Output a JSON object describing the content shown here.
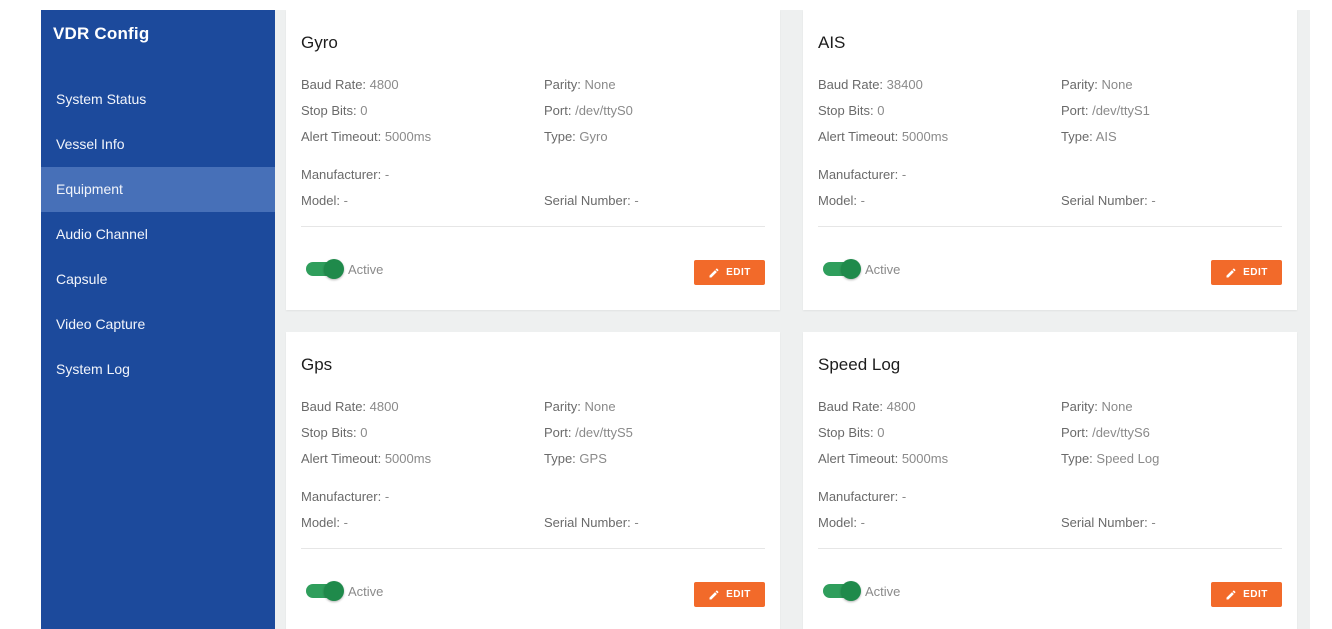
{
  "sidebar": {
    "title": "VDR Config",
    "items": [
      {
        "label": "System Status"
      },
      {
        "label": "Vessel Info"
      },
      {
        "label": "Equipment"
      },
      {
        "label": "Audio Channel"
      },
      {
        "label": "Capsule"
      },
      {
        "label": "Video Capture"
      },
      {
        "label": "System Log"
      }
    ],
    "active_item": "Equipment"
  },
  "labels": {
    "baud_rate": "Baud Rate:",
    "stop_bits": "Stop Bits:",
    "alert_timeout": "Alert Timeout:",
    "parity": "Parity:",
    "port": "Port:",
    "type": "Type:",
    "manufacturer": "Manufacturer:",
    "model": "Model:",
    "serial_number": "Serial Number:",
    "active": "Active",
    "edit": "EDIT"
  },
  "devices": [
    {
      "name": "Gyro",
      "baud_rate": "4800",
      "stop_bits": "0",
      "alert_timeout": "5000ms",
      "parity": "None",
      "port": "/dev/ttyS0",
      "type": "Gyro",
      "manufacturer": "-",
      "model": "-",
      "serial_number": "-",
      "active": true
    },
    {
      "name": "AIS",
      "baud_rate": "38400",
      "stop_bits": "0",
      "alert_timeout": "5000ms",
      "parity": "None",
      "port": "/dev/ttyS1",
      "type": "AIS",
      "manufacturer": "-",
      "model": "-",
      "serial_number": "-",
      "active": true
    },
    {
      "name": "Gps",
      "baud_rate": "4800",
      "stop_bits": "0",
      "alert_timeout": "5000ms",
      "parity": "None",
      "port": "/dev/ttyS5",
      "type": "GPS",
      "manufacturer": "-",
      "model": "-",
      "serial_number": "-",
      "active": true
    },
    {
      "name": "Speed Log",
      "baud_rate": "4800",
      "stop_bits": "0",
      "alert_timeout": "5000ms",
      "parity": "None",
      "port": "/dev/ttyS6",
      "type": "Speed Log",
      "manufacturer": "-",
      "model": "-",
      "serial_number": "-",
      "active": true
    }
  ],
  "colors": {
    "sidebar_bg": "#1c4a9c",
    "sidebar_active": "#4770b8",
    "main_bg": "#eef0f0",
    "toggle_on": "#2f9e5c",
    "edit_button": "#f26a2a"
  },
  "icons": {
    "edit": "pencil-icon"
  }
}
